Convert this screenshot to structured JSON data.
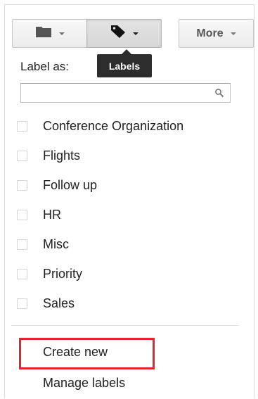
{
  "toolbar": {
    "move_icon": "folder-icon",
    "labels_icon": "tag-icon",
    "more_label": "More",
    "tooltip": "Labels"
  },
  "menu": {
    "heading": "Label as:",
    "search": {
      "value": "",
      "placeholder": "",
      "icon": "search-icon"
    },
    "labels": [
      {
        "label": "Conference Organization",
        "checked": false
      },
      {
        "label": "Flights",
        "checked": false
      },
      {
        "label": "Follow up",
        "checked": false
      },
      {
        "label": "HR",
        "checked": false
      },
      {
        "label": "Misc",
        "checked": false
      },
      {
        "label": "Priority",
        "checked": false
      },
      {
        "label": "Sales",
        "checked": false
      }
    ],
    "create_new": "Create new",
    "manage_labels": "Manage labels"
  },
  "colors": {
    "highlight": "#e8232b",
    "tooltip_bg": "#2d2d2d"
  }
}
